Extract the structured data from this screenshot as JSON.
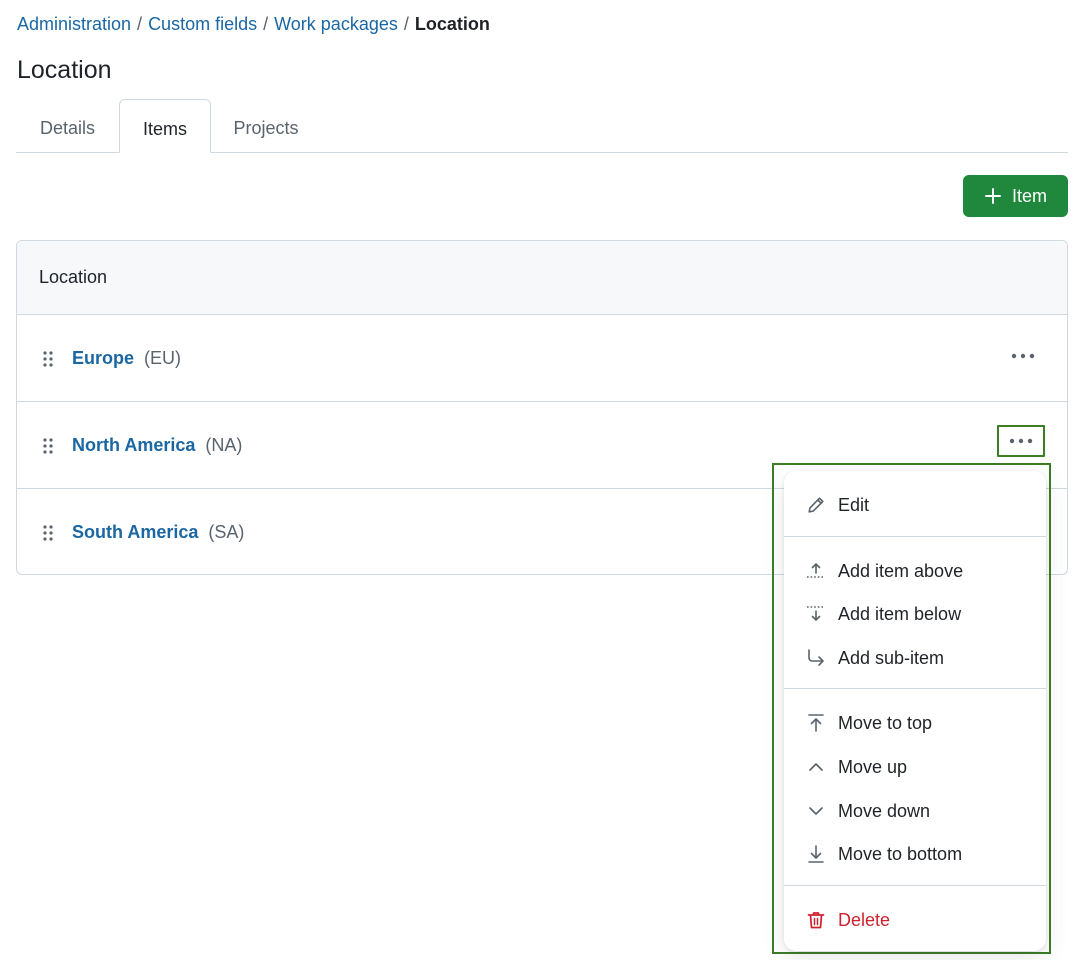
{
  "breadcrumb": {
    "items": [
      "Administration",
      "Custom fields",
      "Work packages"
    ],
    "separator": "/",
    "current": "Location"
  },
  "page": {
    "title": "Location"
  },
  "tabs": [
    {
      "label": "Details",
      "active": false
    },
    {
      "label": "Items",
      "active": true
    },
    {
      "label": "Projects",
      "active": false
    }
  ],
  "toolbar": {
    "add_label": "Item",
    "add_icon": "plus-icon"
  },
  "table": {
    "header": "Location",
    "rows": [
      {
        "name": "Europe",
        "code": "(EU)"
      },
      {
        "name": "North America",
        "code": "(NA)"
      },
      {
        "name": "South America",
        "code": "(SA)"
      }
    ]
  },
  "menu": {
    "edit": {
      "label": "Edit",
      "icon": "pencil-icon"
    },
    "add_above": {
      "label": "Add item above",
      "icon": "add-above-icon"
    },
    "add_below": {
      "label": "Add item below",
      "icon": "add-below-icon"
    },
    "add_sub": {
      "label": "Add sub-item",
      "icon": "arrow-turn-icon"
    },
    "move_top": {
      "label": "Move to top",
      "icon": "move-top-icon"
    },
    "move_up": {
      "label": "Move up",
      "icon": "chevron-up-icon"
    },
    "move_down": {
      "label": "Move down",
      "icon": "chevron-down-icon"
    },
    "move_bottom": {
      "label": "Move to bottom",
      "icon": "move-bottom-icon"
    },
    "delete": {
      "label": "Delete",
      "icon": "trash-icon"
    }
  },
  "colors": {
    "link": "#1a67a3",
    "primary_button": "#1f883d",
    "danger": "#cf222e",
    "highlight_outline": "#3a7d24",
    "border": "#d1d9e0"
  }
}
